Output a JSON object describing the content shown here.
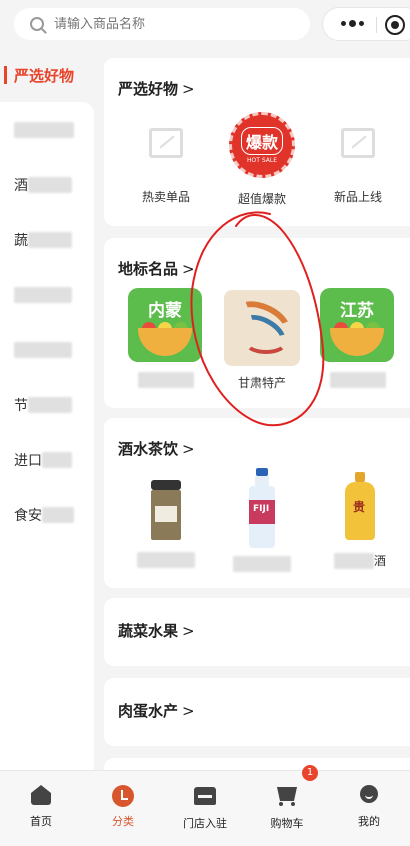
{
  "search": {
    "placeholder": "请输入商品名称"
  },
  "sidebar": {
    "active": "严选好物",
    "items": [
      {
        "visible": "",
        "blurred": true
      },
      {
        "visible": "酒",
        "blurred": true
      },
      {
        "visible": "蔬",
        "blurred": true
      },
      {
        "visible": "",
        "blurred": true
      },
      {
        "visible": "",
        "blurred": true
      },
      {
        "visible": "节",
        "blurred": true
      },
      {
        "visible": "进口",
        "blurred": true
      },
      {
        "visible": "食安",
        "blurred": true
      }
    ]
  },
  "sections": {
    "yanxuan": {
      "title": "严选好物",
      "arrow": ">",
      "items": [
        {
          "label": "热卖单品",
          "icon": "image-placeholder-icon"
        },
        {
          "label": "超值爆款",
          "icon": "hot-sale-badge",
          "badge_text": "爆款",
          "badge_sub": "HOT SALE"
        },
        {
          "label": "新品上线",
          "icon": "image-placeholder-icon"
        }
      ]
    },
    "dibiao": {
      "title": "地标名品",
      "arrow": ">",
      "items": [
        {
          "region": "内蒙",
          "label": ""
        },
        {
          "region": "",
          "label": "甘肃特产"
        },
        {
          "region": "江苏",
          "label": ""
        }
      ]
    },
    "jiushui": {
      "title": "酒水茶饮",
      "arrow": ">",
      "items": [
        {
          "label": "",
          "product": "tea-jar"
        },
        {
          "label": "",
          "product": "water-bottle",
          "brand": "FIJI"
        },
        {
          "label": "酒",
          "product": "liquor-bottle",
          "brand": "贵"
        }
      ]
    },
    "shucai": {
      "title": "蔬菜水果",
      "arrow": ">"
    },
    "roudan": {
      "title": "肉蛋水产",
      "arrow": ">"
    }
  },
  "tabbar": {
    "items": [
      {
        "label": "首页",
        "icon": "home-icon"
      },
      {
        "label": "分类",
        "icon": "category-icon",
        "active": true
      },
      {
        "label": "门店入驻",
        "icon": "store-icon"
      },
      {
        "label": "购物车",
        "icon": "cart-icon",
        "badge": "1"
      },
      {
        "label": "我的",
        "icon": "profile-icon"
      }
    ]
  },
  "colors": {
    "accent": "#e8452c",
    "tab_active": "#d8562d",
    "region_green": "#5cbc4c",
    "annotation": "#e02020"
  }
}
